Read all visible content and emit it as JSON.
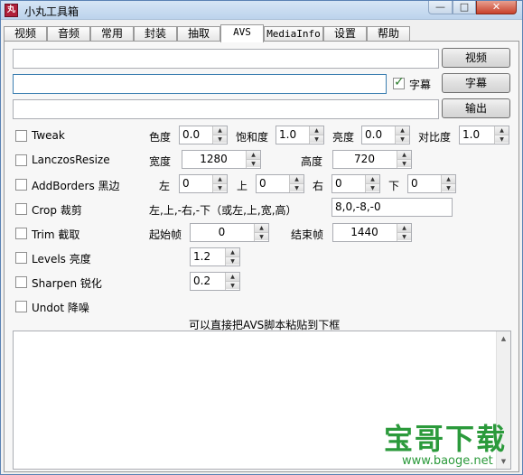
{
  "window": {
    "title": "小丸工具箱",
    "icon_text": "丸",
    "min": "—",
    "max": "□",
    "close": "✕"
  },
  "tabs": [
    "视频",
    "音频",
    "常用",
    "封装",
    "抽取",
    "AVS",
    "MediaInfo",
    "设置",
    "帮助"
  ],
  "buttons": {
    "video": "视频",
    "subtitle": "字幕",
    "output": "输出"
  },
  "subtitle_checkbox": {
    "label": "字幕",
    "checked": true
  },
  "filters": {
    "tweak": {
      "label": "Tweak",
      "hue_label": "色度",
      "hue": "0.0",
      "sat_label": "饱和度",
      "sat": "1.0",
      "bright_label": "亮度",
      "bright": "0.0",
      "contrast_label": "对比度",
      "contrast": "1.0"
    },
    "resize": {
      "label": "LanczosResize",
      "width_label": "宽度",
      "width": "1280",
      "height_label": "高度",
      "height": "720"
    },
    "borders": {
      "label": "AddBorders 黑边",
      "left_label": "左",
      "left": "0",
      "top_label": "上",
      "top": "0",
      "right_label": "右",
      "right": "0",
      "bottom_label": "下",
      "bottom": "0"
    },
    "crop": {
      "label": "Crop 裁剪",
      "hint": "左,上,-右,-下（或左,上,宽,高）",
      "value": "8,0,-8,-0"
    },
    "trim": {
      "label": "Trim 截取",
      "start_label": "起始帧",
      "start": "0",
      "end_label": "结束帧",
      "end": "1440"
    },
    "levels": {
      "label": "Levels 亮度",
      "value": "1.2"
    },
    "sharpen": {
      "label": "Sharpen 锐化",
      "value": "0.2"
    },
    "undot": {
      "label": "Undot 降噪"
    }
  },
  "paste_hint": "可以直接把AVS脚本粘贴到下框",
  "scroll_up": "▲",
  "scroll_down": "▼",
  "spin_up": "▲",
  "spin_down": "▼",
  "watermark": {
    "text": "宝哥下载",
    "url": "www.baoge.net"
  }
}
